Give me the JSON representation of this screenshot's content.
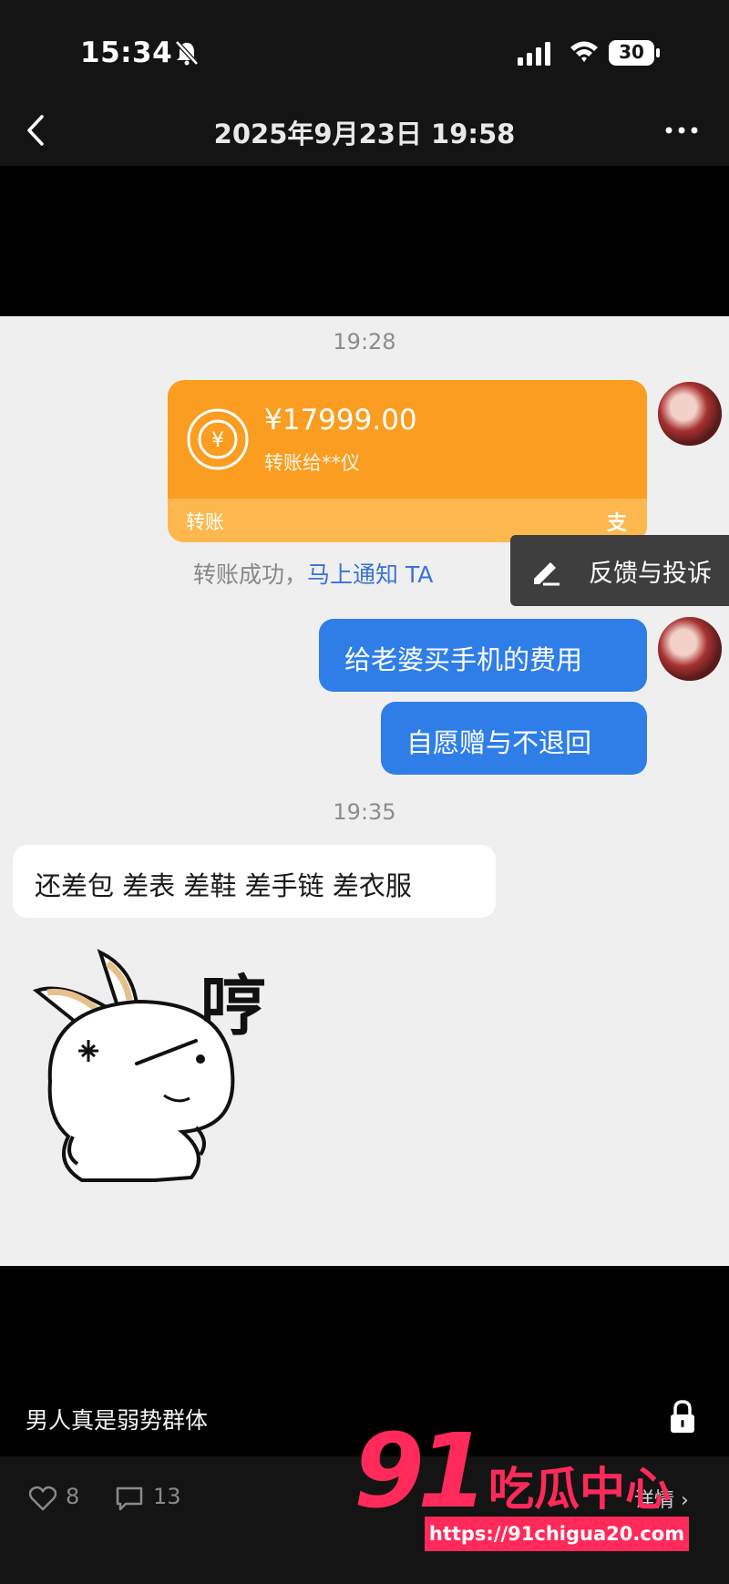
{
  "status_bar": {
    "time": "15:34",
    "battery": "30"
  },
  "nav": {
    "title": "2025年9月23日 19:58"
  },
  "chat": {
    "time_1": "19:28",
    "transfer": {
      "amount": "¥17999.00",
      "recipient": "转账给**仪",
      "footer_label": "转账",
      "provider_glyph": "支"
    },
    "transfer_status": "转账成功，",
    "notify_link": "马上通知 TA",
    "popup_menu": {
      "label": "反馈与投诉"
    },
    "messages_sent": [
      "给老婆买手机的费用",
      "自愿赠与不退回"
    ],
    "time_2": "19:35",
    "message_received": "还差包 差表 差鞋 差手链 差衣服",
    "sticker": {
      "text": "哼",
      "icon": "angry-rabbit-sticker"
    }
  },
  "post": {
    "caption": "男人真是弱势群体",
    "likes": "8",
    "comments": "13",
    "detail_label": "详情"
  },
  "watermark": {
    "number": "91",
    "text": "吃瓜中心",
    "url": "https://91chigua20.com"
  },
  "colors": {
    "transfer": "#fa9d20",
    "bubble_blue": "#2f7ee8",
    "link": "#3a72d6",
    "watermark": "#ff2a5a"
  }
}
